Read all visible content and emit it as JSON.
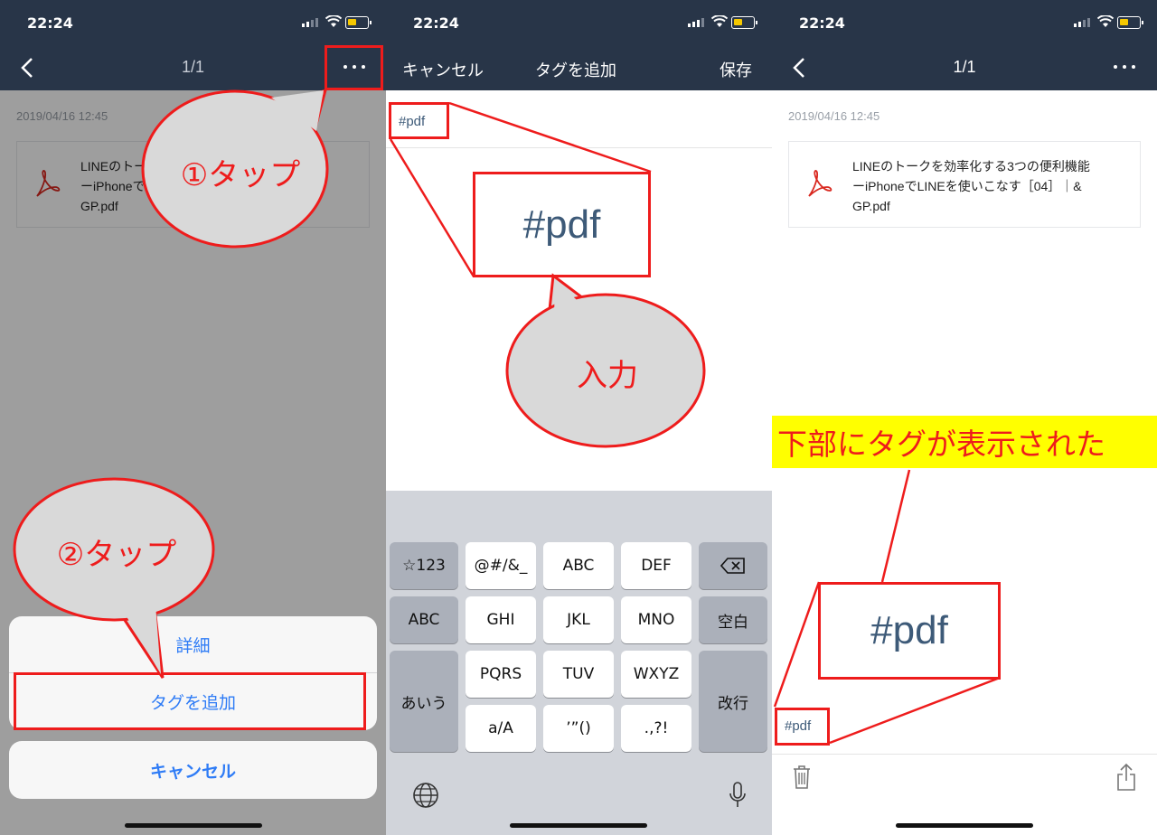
{
  "status": {
    "time": "22:24"
  },
  "panel1": {
    "nav_title": "1/1",
    "date": "2019/04/16 12:45",
    "file_text": "LINEのトークを効率化する3つの便利機能\nーiPhoneでLINEを使いこなす［04］｜&\nGP.pdf",
    "annotation_1": "①タップ",
    "annotation_2": "②タップ",
    "sheet": {
      "details": "詳細",
      "add_tag": "タグを追加",
      "cancel": "キャンセル"
    }
  },
  "panel2": {
    "nav": {
      "cancel": "キャンセル",
      "title": "タグを追加",
      "save": "保存"
    },
    "tag_value": "#pdf",
    "zoom_text": "#pdf",
    "annotation": "入力",
    "keyboard": {
      "rows": [
        [
          "☆123",
          "@#/&_",
          "ABC",
          "DEF",
          "⌫"
        ],
        [
          "ABC",
          "GHI",
          "JKL",
          "MNO",
          "空白"
        ],
        [
          "あいう",
          "PQRS",
          "TUV",
          "WXYZ",
          "改行"
        ],
        [
          "a/A",
          "’”()",
          ".,?!"
        ]
      ]
    }
  },
  "panel3": {
    "nav_title": "1/1",
    "date": "2019/04/16 12:45",
    "file_text": "LINEのトークを効率化する3つの便利機能\nーiPhoneでLINEを使いこなす［04］｜&\nGP.pdf",
    "tag_label": "#pdf",
    "zoom_text": "#pdf",
    "annotation": "下部にタグが表示された"
  },
  "colors": {
    "navbar": "#283548",
    "annotation_red": "#ee1c1c",
    "highlight": "#ffff00",
    "ios_blue": "#2f7cf6"
  },
  "icons": [
    "back-chevron-icon",
    "more-icon",
    "pdf-icon",
    "globe-icon",
    "mic-icon",
    "trash-icon",
    "share-icon",
    "backspace-icon"
  ]
}
